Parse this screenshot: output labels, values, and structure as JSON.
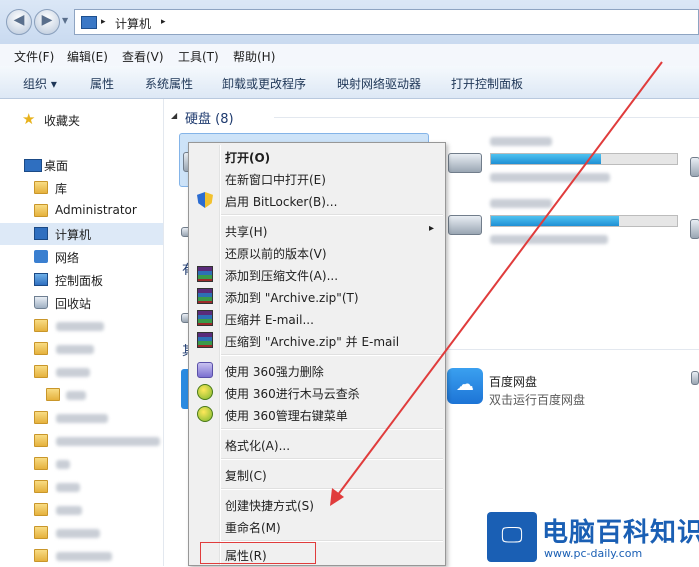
{
  "address": {
    "breadcrumb_root": "▸",
    "location": "计算机",
    "chevron": "▸"
  },
  "menubar": [
    "文件(F)",
    "编辑(E)",
    "查看(V)",
    "工具(T)",
    "帮助(H)"
  ],
  "toolbar": {
    "organize": "组织 ▾",
    "items": [
      "属性",
      "系统属性",
      "卸载或更改程序",
      "映射网络驱动器",
      "打开控制面板"
    ]
  },
  "nav": {
    "favorites": "收藏夹",
    "desktop": "桌面",
    "library": "库",
    "admin": "Administrator",
    "computer": "计算机",
    "network": "网络",
    "control_panel": "控制面板",
    "recycle_bin": "回收站"
  },
  "content": {
    "hard_disks_header": "硬盘 (8)",
    "partial_letters": [
      "有",
      "其"
    ],
    "baidu": {
      "title": "百度网盘",
      "subtitle": "双击运行百度网盘"
    }
  },
  "context_menu": {
    "open": "打开(O)",
    "open_new_window": "在新窗口中打开(E)",
    "bitlocker": "启用 BitLocker(B)...",
    "share": "共享(H)",
    "restore": "还原以前的版本(V)",
    "add_archive": "添加到压缩文件(A)...",
    "add_zip": "添加到 \"Archive.zip\"(T)",
    "compress_email": "压缩并 E-mail...",
    "compress_zip_email": "压缩到 \"Archive.zip\" 并 E-mail",
    "del360": "使用 360强力删除",
    "scan360": "使用 360进行木马云查杀",
    "manage360": "使用 360管理右键菜单",
    "format": "格式化(A)...",
    "copy": "复制(C)",
    "shortcut": "创建快捷方式(S)",
    "rename": "重命名(M)",
    "properties": "属性(R)",
    "submenu_arrow": "▸"
  },
  "watermark": {
    "title": "电脑百科知识",
    "url": "www.pc-daily.com"
  },
  "colors": {
    "accent": "#1a5fb4",
    "highlight_box": "#e03c3c",
    "arrow": "#e03c3c"
  }
}
